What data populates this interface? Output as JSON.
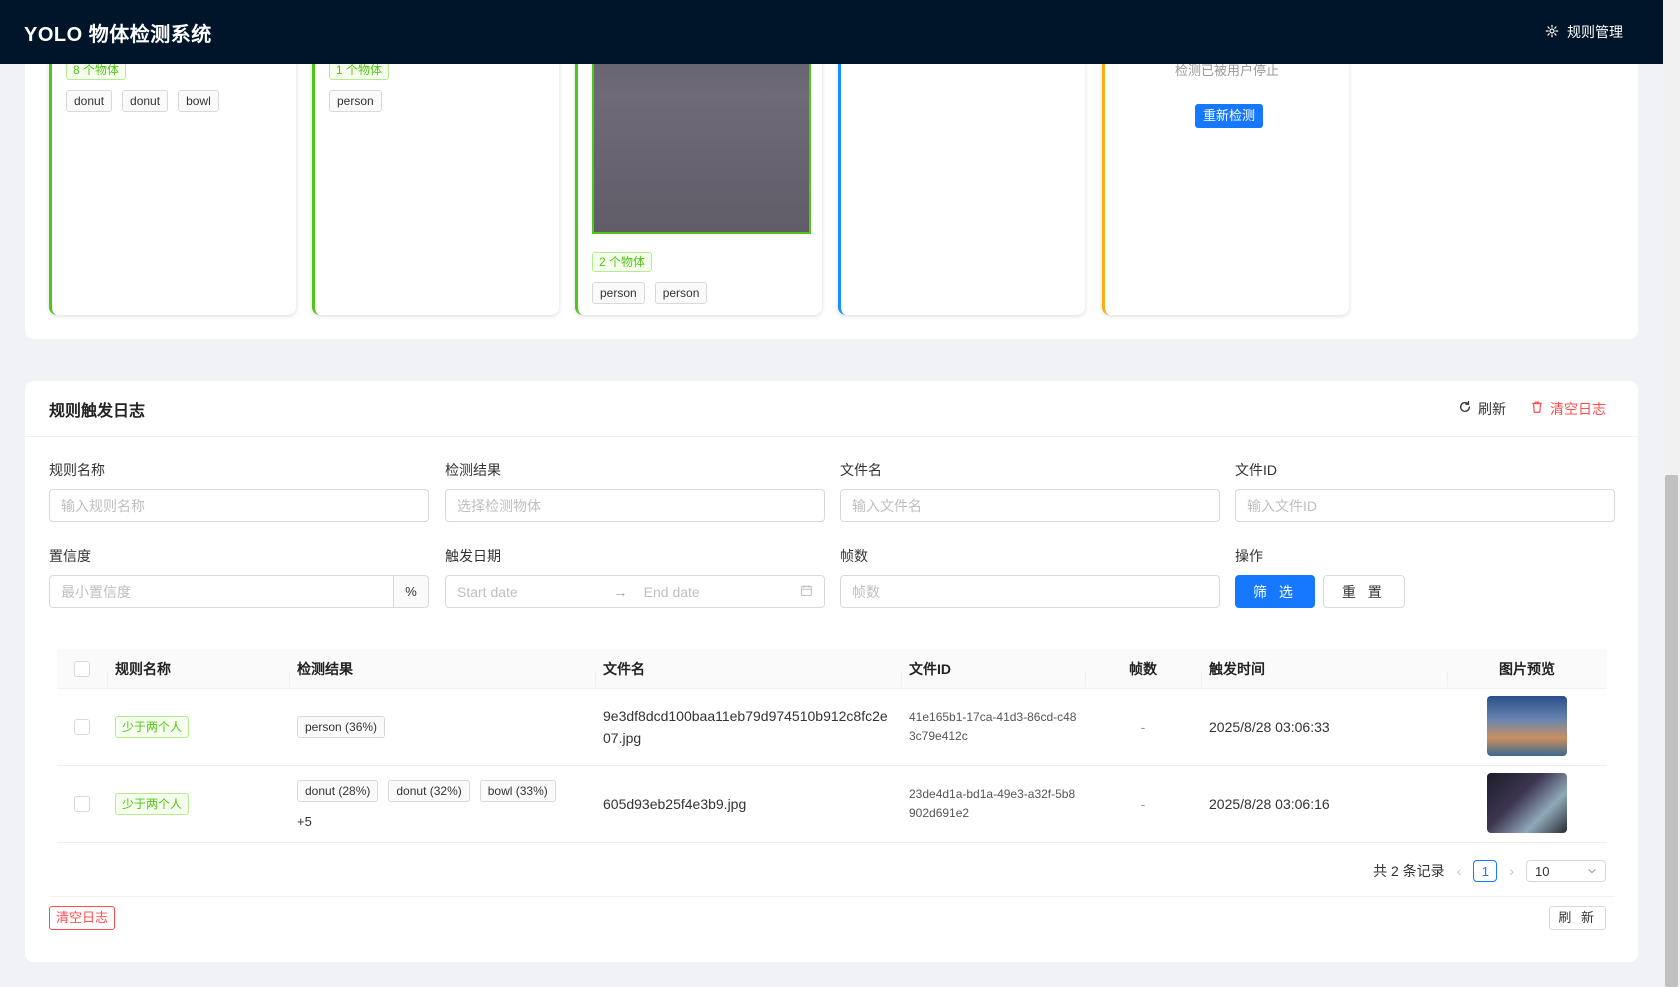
{
  "header": {
    "title": "YOLO 物体检测系统",
    "rules_label": "规则管理"
  },
  "cards": [
    {
      "count": "8 个物体",
      "tags": [
        "donut",
        "donut",
        "bowl"
      ]
    },
    {
      "count": "1 个物体",
      "tags": [
        "person"
      ]
    },
    {
      "count": "2 个物体",
      "tags": [
        "person",
        "person"
      ]
    },
    {
      "status": ""
    },
    {
      "status": "检测已被用户停止",
      "action": "重新检测"
    }
  ],
  "log": {
    "title": "规则触发日志",
    "refresh_label": "刷新",
    "clear_label": "清空日志",
    "filters": {
      "rule_name": {
        "label": "规则名称",
        "placeholder": "输入规则名称"
      },
      "result": {
        "label": "检测结果",
        "placeholder": "选择检测物体"
      },
      "filename": {
        "label": "文件名",
        "placeholder": "输入文件名"
      },
      "file_id": {
        "label": "文件ID",
        "placeholder": "输入文件ID"
      },
      "confidence": {
        "label": "置信度",
        "placeholder": "最小置信度",
        "suffix": "%"
      },
      "date": {
        "label": "触发日期",
        "start": "Start date",
        "end": "End date"
      },
      "frames": {
        "label": "帧数",
        "placeholder": "帧数"
      },
      "ops": {
        "label": "操作",
        "filter_btn": "筛 选",
        "reset_btn": "重 置"
      }
    },
    "columns": [
      "规则名称",
      "检测结果",
      "文件名",
      "文件ID",
      "帧数",
      "触发时间",
      "图片预览"
    ],
    "rows": [
      {
        "rule": "少于两个人",
        "results": [
          "person (36%)"
        ],
        "more": "",
        "filename": "9e3df8dcd100baa11eb79d974510b912c8fc2e07.jpg",
        "file_id": "41e165b1-17ca-41d3-86cd-c483c79e412c",
        "frames": "-",
        "time": "2025/8/28 03:06:33"
      },
      {
        "rule": "少于两个人",
        "results": [
          "donut (28%)",
          "donut (32%)",
          "bowl (33%)"
        ],
        "more": "+5",
        "filename": "605d93eb25f4e3b9.jpg",
        "file_id": "23de4d1a-bd1a-49e3-a32f-5b8902d691e2",
        "frames": "-",
        "time": "2025/8/28 03:06:16"
      }
    ],
    "pagination": {
      "total": "共 2 条记录",
      "current": "1",
      "page_size": "10"
    },
    "footer": {
      "clear": "清空日志",
      "refresh": "刷 新"
    }
  },
  "colors": {
    "header_bg": "#001529",
    "primary": "#1677ff",
    "success": "#52c41a",
    "danger": "#ff4d4f",
    "warning": "#faad14"
  }
}
